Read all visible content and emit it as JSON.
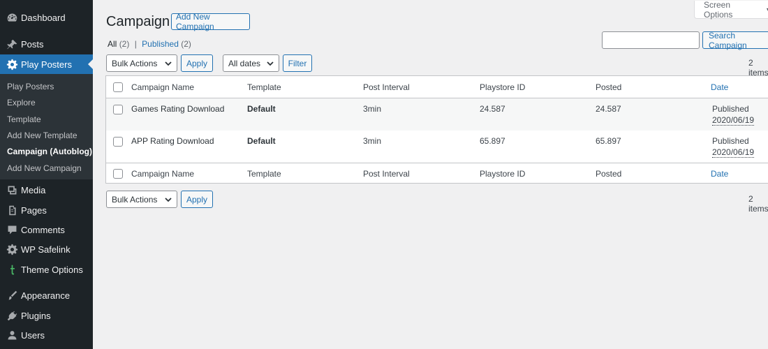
{
  "sidebar": {
    "top_items": [
      {
        "label": "Dashboard",
        "icon": "dashboard-icon"
      },
      {
        "label": "Posts",
        "icon": "pin-icon"
      },
      {
        "label": "Play Posters",
        "icon": "gear-icon",
        "active": true
      }
    ],
    "submenu": [
      {
        "label": "Play Posters"
      },
      {
        "label": "Explore"
      },
      {
        "label": "Template"
      },
      {
        "label": "Add New Template"
      },
      {
        "label": "Campaign (Autoblog)",
        "current": true
      },
      {
        "label": "Add New Campaign"
      }
    ],
    "bottom_items": [
      {
        "label": "Media",
        "icon": "media-icon"
      },
      {
        "label": "Pages",
        "icon": "pages-icon"
      },
      {
        "label": "Comments",
        "icon": "comment-icon"
      },
      {
        "label": "WP Safelink",
        "icon": "gear-icon"
      },
      {
        "label": "Theme Options",
        "icon": "theme-t-icon"
      },
      {
        "label": "Appearance",
        "icon": "brush-icon"
      },
      {
        "label": "Plugins",
        "icon": "plug-icon"
      },
      {
        "label": "Users",
        "icon": "user-icon"
      }
    ]
  },
  "screen_options": "Screen Options",
  "page": {
    "title": "Campaign",
    "add_new": "Add New Campaign"
  },
  "filters": {
    "all_label": "All",
    "all_count": "(2)",
    "separator": "|",
    "published_label": "Published",
    "published_count": "(2)"
  },
  "search": {
    "value": "",
    "button": "Search Campaign"
  },
  "top_actions": {
    "bulk": "Bulk Actions",
    "apply": "Apply",
    "dates": "All dates",
    "filter": "Filter",
    "count": "2 items"
  },
  "bottom_actions": {
    "bulk": "Bulk Actions",
    "apply": "Apply",
    "count": "2 items"
  },
  "table": {
    "columns": [
      "Campaign Name",
      "Template",
      "Post Interval",
      "Playstore ID",
      "Posted",
      "Date"
    ],
    "rows": [
      {
        "name": "Games Rating Download",
        "template": "Default",
        "interval": "3min",
        "playstore_id": "24.587",
        "posted": "24.587",
        "status": "Published",
        "date": "2020/06/19"
      },
      {
        "name": "APP Rating Download",
        "template": "Default",
        "interval": "3min",
        "playstore_id": "65.897",
        "posted": "65.897",
        "status": "Published",
        "date": "2020/06/19"
      }
    ]
  },
  "colors": {
    "sidebar_bg": "#1d2327",
    "submenu_bg": "#2c3338",
    "accent": "#2271b1",
    "page_bg": "#f0f0f1"
  }
}
